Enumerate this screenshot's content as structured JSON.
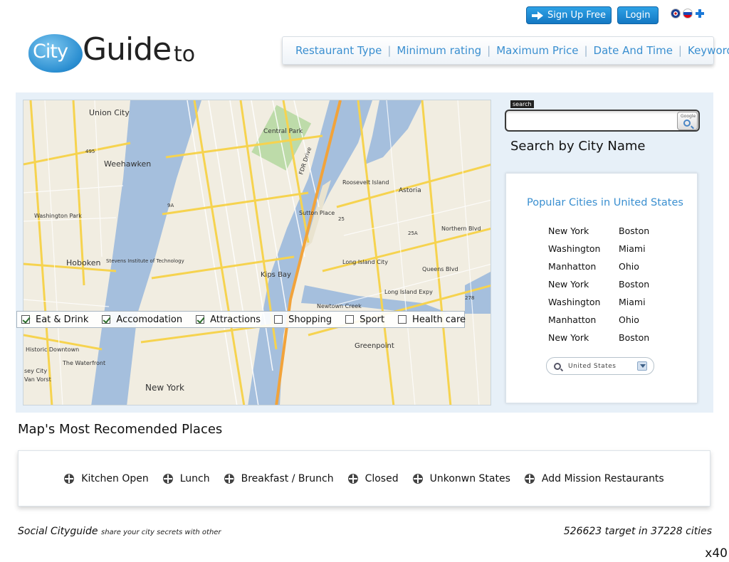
{
  "header": {
    "signup_label": "Sign Up Free",
    "login_label": "Login",
    "flags": [
      "uk-flag",
      "russia-flag",
      "finland-flag"
    ]
  },
  "logo": {
    "bubble": "City",
    "main": "Guide",
    "suffix": "to"
  },
  "filters": [
    "Restaurant Type",
    "Minimum rating",
    "Maximum Price",
    "Date And Time",
    "Keyword"
  ],
  "map": {
    "labels": {
      "union_city": "Union City",
      "weehawken": "Weehawken",
      "hoboken": "Hoboken",
      "central_park": "Central Park",
      "roosevelt_island": "Roosevelt Island",
      "astoria": "Astoria",
      "long_island_city": "Long Island City",
      "kips_bay": "Kips Bay",
      "sutton_place": "Sutton Place",
      "new_york": "New York",
      "greenpoint": "Greenpoint",
      "stevens": "Stevens Institute of Technology",
      "washington_park": "Washington Park",
      "historic_downtown": "Historic Downtown",
      "the_waterfront": "The Waterfront",
      "sey_city": "sey City",
      "van_vorst": "Van Vorst",
      "queens_blvd": "Queens Blvd",
      "long_island_expy": "Long Island Expy",
      "northern_blvd": "Northern Blvd",
      "newtown_creek": "Newtown Creek",
      "fdr_drive": "FDR Drive",
      "route_495": "495",
      "route_25": "25",
      "route_25a": "25A",
      "route_278": "278",
      "route_9a": "9A"
    },
    "categories": [
      {
        "label": "Eat & Drink",
        "checked": true
      },
      {
        "label": "Accomodation",
        "checked": true
      },
      {
        "label": "Attractions",
        "checked": true
      },
      {
        "label": "Shopping",
        "checked": false
      },
      {
        "label": "Sport",
        "checked": false
      },
      {
        "label": "Health care",
        "checked": false
      }
    ]
  },
  "search": {
    "tag": "search",
    "button_label": "Google",
    "value": "",
    "label": "Search by City Name"
  },
  "popular": {
    "title": "Popular Cities in United States",
    "col1": [
      "New York",
      "Washington",
      "Manhatton",
      "New York",
      "Washington",
      "Manhatton",
      "New York"
    ],
    "col2": [
      "Boston",
      "Miami",
      "Ohio",
      "Boston",
      "Miami",
      "Ohio",
      "Boston"
    ],
    "country_value": "United States"
  },
  "recommended": {
    "title": "Map's Most Recomended Places",
    "items": [
      "Kitchen Open",
      "Lunch",
      "Breakfast / Brunch",
      "Closed",
      "Unkonwn States",
      "Add Mission Restaurants"
    ]
  },
  "footer": {
    "brand": "Social Cityguide",
    "tagline": "share your city secrets with other",
    "stats": "526623 target in 37228 cities",
    "zoom": "x40"
  },
  "colors": {
    "accent": "#3a8fd0",
    "button": "#1e88d3",
    "panel_bg": "#e7f0f8",
    "water": "#a5bfdd",
    "land": "#f1ede1",
    "road": "#f6d34f"
  }
}
